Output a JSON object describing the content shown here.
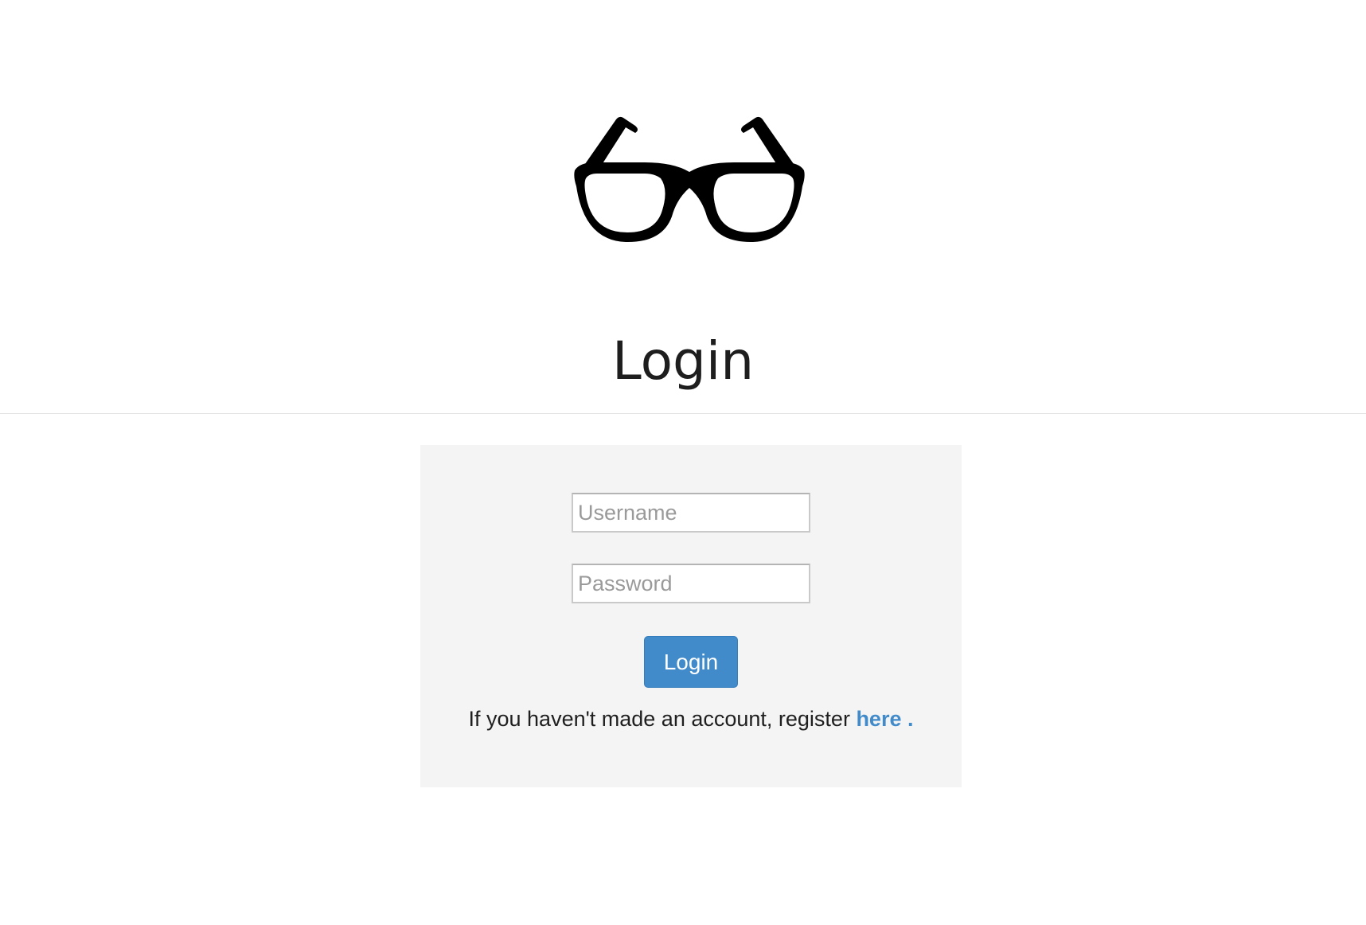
{
  "logo": {
    "icon": "glasses-icon"
  },
  "page": {
    "title": "Login"
  },
  "form": {
    "username_placeholder": "Username",
    "password_placeholder": "Password",
    "submit_label": "Login"
  },
  "register": {
    "text": "If you haven't made an account, register ",
    "link_label": "here",
    "trailing": " ."
  },
  "colors": {
    "accent": "#428bca",
    "panel_background": "#f4f4f4",
    "divider": "#e3e3e3"
  }
}
